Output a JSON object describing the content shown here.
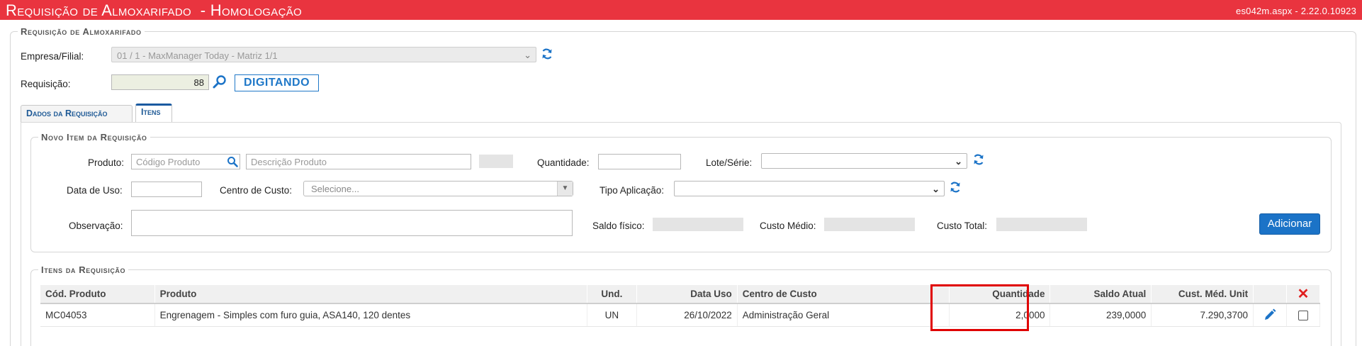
{
  "window": {
    "title": "Requisição de Almoxarifado  - Homologação",
    "version": "es042m.aspx - 2.22.0.10923"
  },
  "header_section": {
    "legend": "Requisição de Almoxarifado",
    "empresa_label": "Empresa/Filial:",
    "empresa_value": "01 / 1 - MaxManager Today - Matriz 1/1",
    "requisicao_label": "Requisição:",
    "requisicao_value": "88",
    "status": "DIGITANDO"
  },
  "tabs": [
    {
      "label": "Dados da Requisição"
    },
    {
      "label": "Itens"
    }
  ],
  "novo_item": {
    "legend": "Novo Item da Requisição",
    "produto_label": "Produto:",
    "codigo_placeholder": "Código Produto",
    "descricao_placeholder": "Descrição Produto",
    "quantidade_label": "Quantidade:",
    "lote_label": "Lote/Série:",
    "data_uso_label": "Data de Uso:",
    "centro_custo_label": "Centro de Custo:",
    "centro_custo_placeholder": "Selecione...",
    "tipo_aplicacao_label": "Tipo Aplicação:",
    "observacao_label": "Observação:",
    "saldo_fisico_label": "Saldo físico:",
    "custo_medio_label": "Custo Médio:",
    "custo_total_label": "Custo Total:",
    "adicionar_label": "Adicionar"
  },
  "itens": {
    "legend": "Itens da Requisição",
    "columns": [
      "Cód. Produto",
      "Produto",
      "Und.",
      "Data Uso",
      "Centro de Custo",
      "Quantidade",
      "Saldo Atual",
      "Cust. Méd. Unit",
      "",
      "✕"
    ],
    "rows": [
      {
        "codigo": "MC04053",
        "produto": "Engrenagem - Simples com furo guia, ASA140, 120 dentes",
        "und": "UN",
        "data_uso": "26/10/2022",
        "centro_custo": "Administração Geral",
        "quantidade": "2,0000",
        "saldo_atual": "239,0000",
        "custo_medio": "7.290,3700"
      }
    ]
  },
  "colors": {
    "title_bar": "#e9343f",
    "accent_blue": "#1b73c7",
    "highlight_red": "#e00000"
  }
}
